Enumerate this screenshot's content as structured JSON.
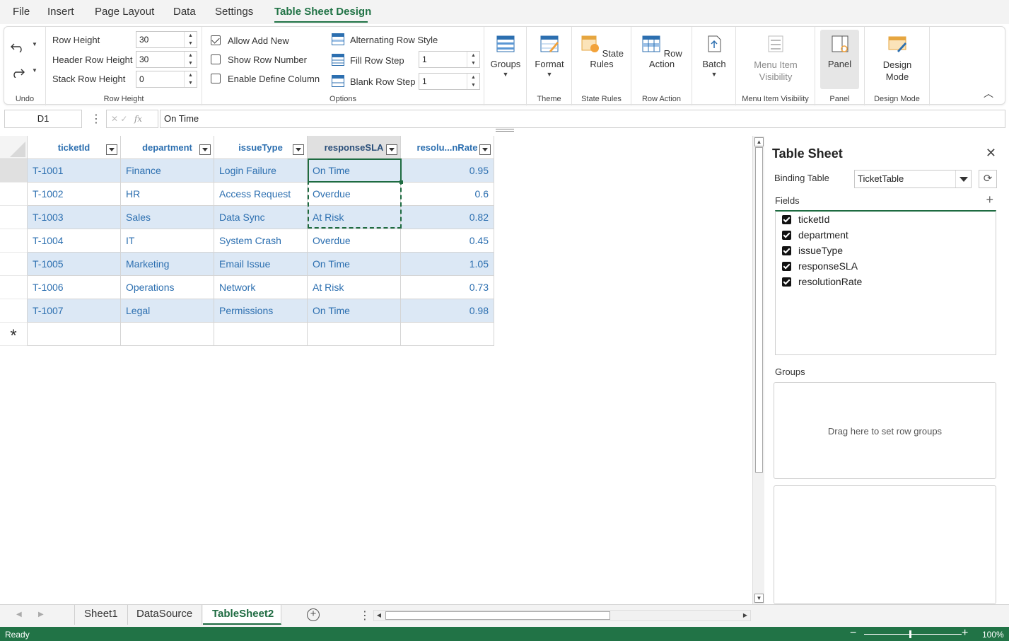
{
  "menu": {
    "items": [
      "File",
      "Insert",
      "Page Layout",
      "Data",
      "Settings",
      "Table Sheet Design"
    ],
    "active_index": 5
  },
  "ribbon": {
    "undo_group": {
      "label": "Undo"
    },
    "row_height_group": {
      "label": "Row Height",
      "row_height_label": "Row Height",
      "row_height_value": "30",
      "header_row_height_label": "Header Row Height",
      "header_row_height_value": "30",
      "stack_row_height_label": "Stack Row Height",
      "stack_row_height_value": "0"
    },
    "options_group": {
      "label": "Options",
      "allow_add_new": "Allow Add New",
      "show_row_number": "Show Row Number",
      "enable_define_column": "Enable Define Column",
      "alternating_row_style": "Alternating Row Style",
      "fill_row_step_label": "Fill Row Step",
      "fill_row_step_value": "1",
      "blank_row_step_label": "Blank Row Step",
      "blank_row_step_value": "1",
      "allow_add_new_checked": true,
      "show_row_number_checked": false,
      "enable_define_column_checked": false
    },
    "groups_btn": "Groups",
    "format_btn": "Format",
    "theme_label": "Theme",
    "state_rules_btn": "State Rules",
    "state_rules_label": "State Rules",
    "row_action_btn": "Row Action",
    "row_action_label": "Row Action",
    "batch_btn": "Batch",
    "menu_item_visibility_btn": "Menu Item Visibility",
    "menu_item_visibility_label": "Menu Item Visibility",
    "panel_btn": "Panel",
    "panel_label": "Panel",
    "design_mode_btn": "Design Mode",
    "design_mode_label": "Design Mode"
  },
  "formula_bar": {
    "cell_ref": "D1",
    "formula": "On Time"
  },
  "table": {
    "columns": [
      "ticketId",
      "department",
      "issueType",
      "responseSLA",
      "resolu...nRate"
    ],
    "rows": [
      [
        "T-1001",
        "Finance",
        "Login Failure",
        "On Time",
        "0.95"
      ],
      [
        "T-1002",
        "HR",
        "Access Request",
        "Overdue",
        "0.6"
      ],
      [
        "T-1003",
        "Sales",
        "Data Sync",
        "At Risk",
        "0.82"
      ],
      [
        "T-1004",
        "IT",
        "System Crash",
        "Overdue",
        "0.45"
      ],
      [
        "T-1005",
        "Marketing",
        "Email Issue",
        "On Time",
        "1.05"
      ],
      [
        "T-1006",
        "Operations",
        "Network",
        "At Risk",
        "0.73"
      ],
      [
        "T-1007",
        "Legal",
        "Permissions",
        "On Time",
        "0.98"
      ]
    ],
    "new_row_marker": "*"
  },
  "panel": {
    "title": "Table Sheet",
    "binding_table_label": "Binding Table",
    "binding_table_value": "TicketTable",
    "fields_label": "Fields",
    "fields": [
      "ticketId",
      "department",
      "issueType",
      "responseSLA",
      "resolutionRate"
    ],
    "groups_label": "Groups",
    "groups_placeholder": "Drag here to set row groups"
  },
  "sheet_tabs": {
    "tabs": [
      "Sheet1",
      "DataSource",
      "TableSheet2"
    ],
    "active_index": 2
  },
  "status_bar": {
    "status": "Ready",
    "zoom": "100%"
  },
  "colors": {
    "accent": "#217346",
    "header_text": "#2c6fb0",
    "alt_row": "#dce8f5"
  }
}
